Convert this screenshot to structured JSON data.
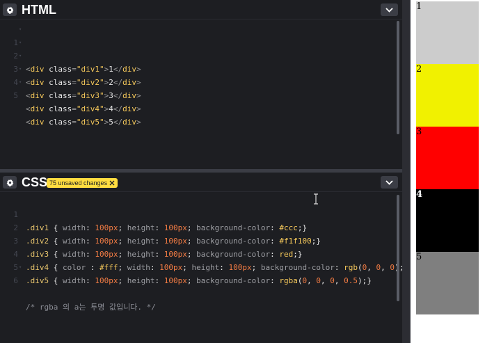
{
  "html_panel": {
    "title": "HTML",
    "lines": [
      {
        "num": "1",
        "div_class": "div1",
        "content": "1"
      },
      {
        "num": "2",
        "div_class": "div2",
        "content": "2"
      },
      {
        "num": "3",
        "div_class": "div3",
        "content": "3"
      },
      {
        "num": "4",
        "div_class": "div4",
        "content": "4"
      },
      {
        "num": "5",
        "div_class": "div5",
        "content": "5"
      }
    ]
  },
  "css_panel": {
    "title": "CSS",
    "unsaved_badge": "75 unsaved changes",
    "line_numbers": [
      "1",
      "2",
      "3",
      "4",
      "5",
      "6"
    ]
  },
  "preview": {
    "boxes": [
      {
        "label": "1",
        "bg": "#cccccc",
        "color": "#000000"
      },
      {
        "label": "2",
        "bg": "#f1f100",
        "color": "#000000"
      },
      {
        "label": "3",
        "bg": "#ff0000",
        "color": "#000000"
      },
      {
        "label": "4",
        "bg": "#000000",
        "color": "#ffffff"
      },
      {
        "label": "5",
        "bg": "rgba(0,0,0,0.5)",
        "color": "#000000"
      }
    ]
  },
  "icons": {
    "settings": "gear-icon",
    "collapse": "chevron-down-icon",
    "close": "close-icon"
  }
}
